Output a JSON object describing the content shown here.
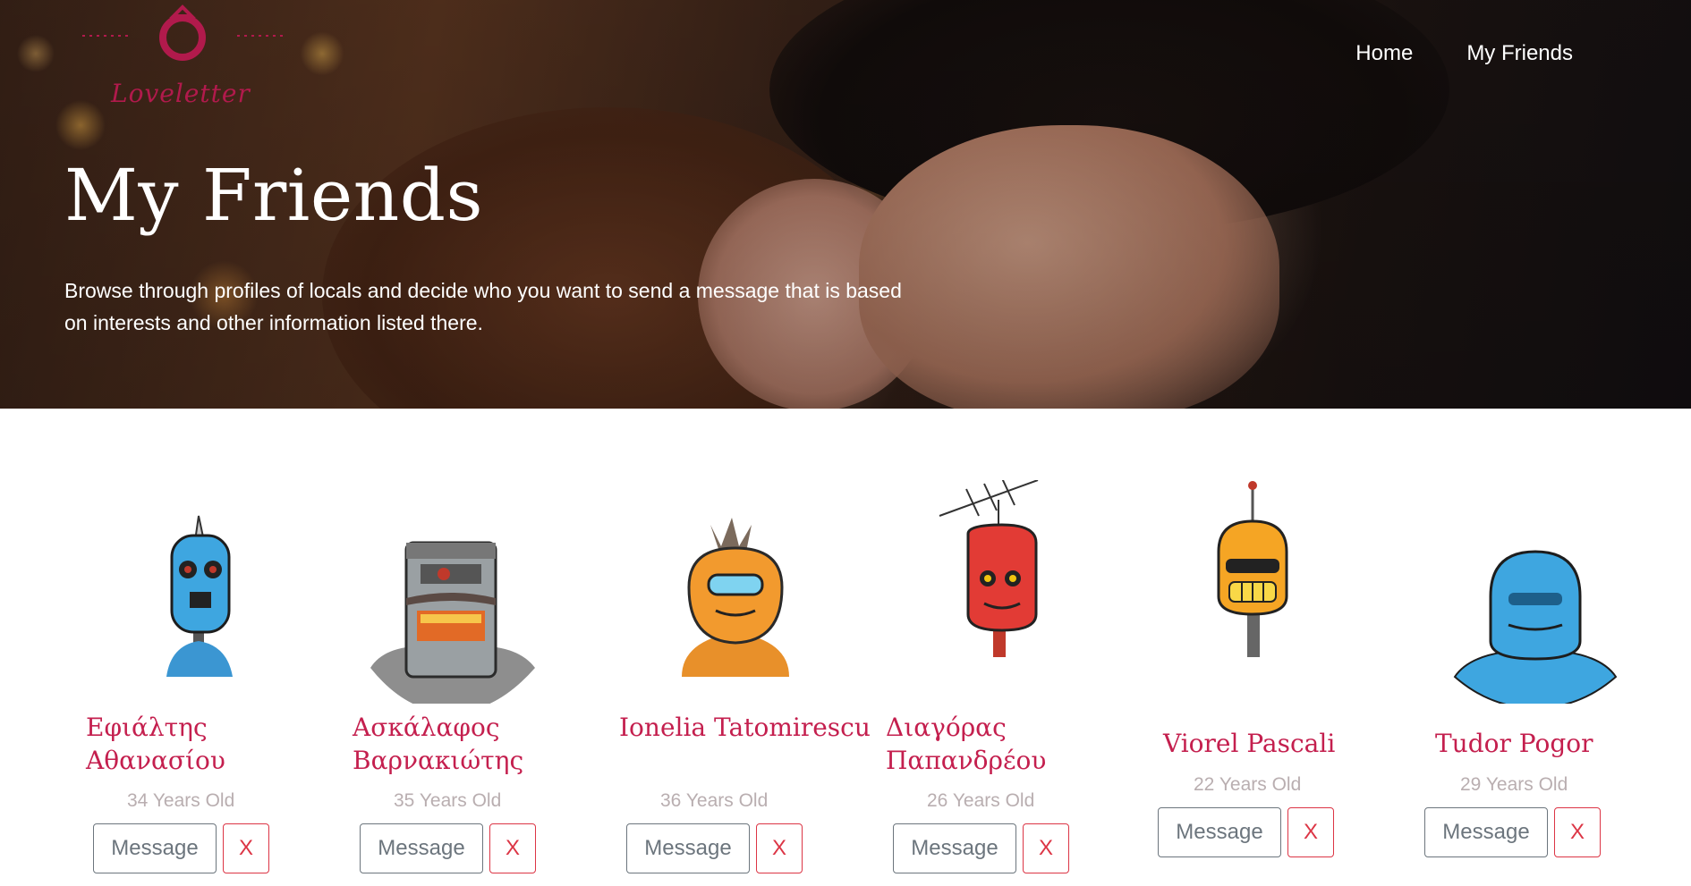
{
  "brand": {
    "name": "Loveletter"
  },
  "nav": {
    "home": "Home",
    "my_friends": "My Friends"
  },
  "hero": {
    "title": "My Friends",
    "description": "Browse through profiles of locals and decide who you want to send a message that is based on interests and other information listed there."
  },
  "friends": [
    {
      "name": "Εφιάλτης Αθανασίου",
      "age": "34 Years Old",
      "message_label": "Message",
      "remove_label": "X",
      "robot": "blue-antenna-robot-icon"
    },
    {
      "name": "Ασκάλαφος Βαρνακιώτης",
      "age": "35 Years Old",
      "message_label": "Message",
      "remove_label": "X",
      "robot": "grey-mustache-robot-icon"
    },
    {
      "name": "Ionelia Tatomirescu",
      "age": "36 Years Old",
      "message_label": "Message",
      "remove_label": "X",
      "robot": "orange-visor-robot-icon"
    },
    {
      "name": "Διαγόρας Παπανδρέου",
      "age": "26 Years Old",
      "message_label": "Message",
      "remove_label": "X",
      "robot": "red-antenna-robot-icon"
    },
    {
      "name": "Viorel Pascali",
      "age": "22 Years Old",
      "message_label": "Message",
      "remove_label": "X",
      "robot": "orange-grin-robot-icon"
    },
    {
      "name": "Tudor Pogor",
      "age": "29 Years Old",
      "message_label": "Message",
      "remove_label": "X",
      "robot": "blue-visor-robot-icon"
    }
  ],
  "colors": {
    "accent": "#c41f4e",
    "muted": "#b9aeb0",
    "danger": "#dc3545",
    "secondary": "#6c757d"
  }
}
